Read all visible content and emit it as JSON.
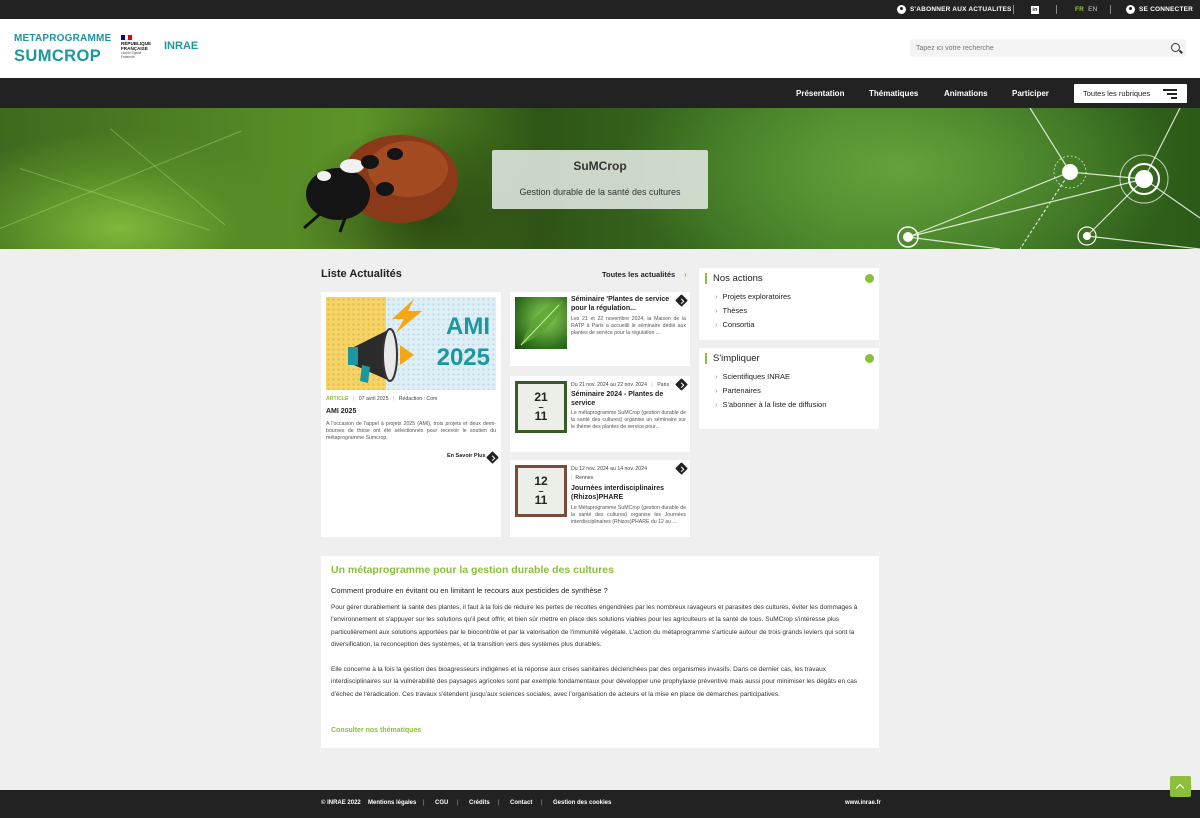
{
  "topbar": {
    "subscribe": "S'ABONNER AUX ACTUALITES",
    "linkedin": "in",
    "lang_fr": "FR",
    "lang_en": "EN",
    "login": "SE CONNECTER"
  },
  "header": {
    "brand_line1": "METAPROGRAMME",
    "brand_line2": "SUMCROP",
    "rf_line1": "RÉPUBLIQUE",
    "rf_line2": "FRANÇAISE",
    "rf_motto": "Liberté Égalité Fraternité",
    "inrae": "INRAE",
    "search_placeholder": "Tapez ici votre recherche"
  },
  "nav": {
    "items": [
      "Présentation",
      "Thématiques",
      "Animations",
      "Participer"
    ],
    "all_label": "Toutes les rubriques"
  },
  "hero": {
    "title": "SuMCrop",
    "subtitle": "Gestion durable de la santé des cultures"
  },
  "news": {
    "title": "Liste Actualités",
    "all_link": "Toutes les actualités",
    "featured": {
      "image_text_1": "AMI",
      "image_text_2": "2025",
      "tag": "ARTICLE",
      "date": "07 avril 2025",
      "author": "Rédaction : Com",
      "title": "AMI 2025",
      "text": "A l'occasion de l'appel à projets 2025 (AMI), trois projets et deux demi-bourses de thèse ont été sélectionnés pour recevoir le soutien du métaprogramme Sumcrop.",
      "more": "En Savoir Plus"
    },
    "items": [
      {
        "title": "Séminaire 'Plantes de service pour la régulation...",
        "text": "Les 21 et 22 novembre 2024, la Maison de la RATP à Paris a accueilli le séminaire dédié aux plantes de service pour la régulation ..."
      },
      {
        "cal_top": "21",
        "cal_bottom": "11",
        "dates": "Du 21 nov. 2024 au 22 nov. 2024",
        "place": "Paris",
        "title": "Séminaire 2024 - Plantes de service",
        "text": "Le métaprogramme SuMCrop (gestion durable de la santé des cultures) organise un séminaire sur le thème des plantes de service pour..."
      },
      {
        "cal_top": "12",
        "cal_bottom": "11",
        "dates": "Du 12 nov. 2024 au 14 nov. 2024",
        "place": "Rennes",
        "title": "Journées interdisciplinaires (Rhizos)PHARE",
        "text": "Le Métaprogramme SuMCrop (gestion durable de la santé des cultures) organise les Journées interdisciplinaires (Rhizos)PHARE du 12 au ..."
      }
    ]
  },
  "sidebar": {
    "actions_title": "Nos actions",
    "actions": [
      "Projets exploratoires",
      "Thèses",
      "Consortia"
    ],
    "involve_title": "S'impliquer",
    "involve": [
      "Scientifiques INRAE",
      "Partenaires",
      "S'abonner à la liste de diffusion"
    ]
  },
  "about": {
    "title": "Un métaprogramme pour la gestion durable des cultures",
    "question": "Comment produire en évitant ou en limitant le recours aux pesticides de synthèse ?",
    "p1": "Pour gérer durablement la santé des plantes, il faut à la fois de réduire les pertes de récoltes engendrées par les nombreux ravageurs et parasites des cultures, éviter les dommages à l'environnement et s'appuyer sur les solutions qu'il peut offrir, et bien sûr mettre en place des solutions viables pour les agriculteurs et la santé de tous.  SuMCrop s'intéresse plus particulièrement aux solutions apportées par le biocontrôle et par la valorisation de l'immunité végétale. L'action du métaprogramme s'articule autour de trois grands leviers qui sont la diversification, la reconception des systèmes, et la transition vers des systèmes plus durables.",
    "p2": "Elle concerne à la fois la gestion des bioagresseurs indigènes et la réponse aux crises sanitaires déclenchées par des organismes invasifs. Dans ce dernier cas, les travaux interdisciplinaires sur la vulnérabilité des paysages agricoles sont par exemple fondamentaux pour développer une prophylaxie préventive mais aussi pour minimiser les dégâts en cas d'échec de l'éradication. Ces travaux s'étendent jusqu'aux sciences sociales, avec l'organisation de acteurs et la mise en place de démarches participatives.",
    "more": "Consulter nos thématiques"
  },
  "footer": {
    "copyright": "© INRAE 2022",
    "links": [
      "Mentions légales",
      "CGU",
      "Crédits",
      "Contact",
      "Gestion des cookies"
    ],
    "site": "www.inrae.fr"
  },
  "colors": {
    "accent_green": "#8bbf3c",
    "brand_teal": "#1c97a0",
    "dark": "#222222"
  }
}
